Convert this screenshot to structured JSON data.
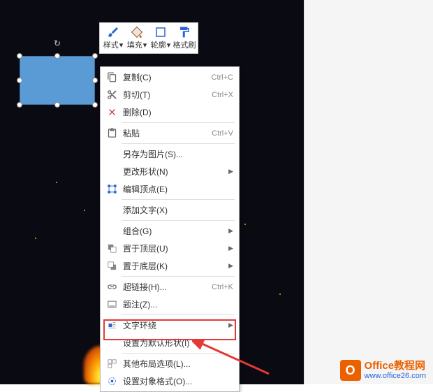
{
  "toolbar": {
    "style": "样式",
    "fill": "填充",
    "outline": "轮廓",
    "format_painter": "格式刷"
  },
  "menu": {
    "copy": {
      "label": "复制(C)",
      "shortcut": "Ctrl+C"
    },
    "cut": {
      "label": "剪切(T)",
      "shortcut": "Ctrl+X"
    },
    "delete": {
      "label": "删除(D)",
      "shortcut": ""
    },
    "paste": {
      "label": "粘贴",
      "shortcut": "Ctrl+V"
    },
    "save_as_pic": {
      "label": "另存为图片(S)..."
    },
    "change_shape": {
      "label": "更改形状(N)"
    },
    "edit_points": {
      "label": "编辑顶点(E)"
    },
    "add_text": {
      "label": "添加文字(X)"
    },
    "group": {
      "label": "组合(G)"
    },
    "bring_front": {
      "label": "置于顶层(U)"
    },
    "send_back": {
      "label": "置于底层(K)"
    },
    "hyperlink": {
      "label": "超链接(H)...",
      "shortcut": "Ctrl+K"
    },
    "annotation": {
      "label": "题注(Z)..."
    },
    "text_wrap": {
      "label": "文字环绕"
    },
    "set_default": {
      "label": "设置为默认形状(I)"
    },
    "other_layout": {
      "label": "其他布局选项(L)..."
    },
    "format_object": {
      "label": "设置对象格式(O)..."
    }
  },
  "watermark": {
    "title": "Office教程网",
    "url": "www.office26.com"
  }
}
